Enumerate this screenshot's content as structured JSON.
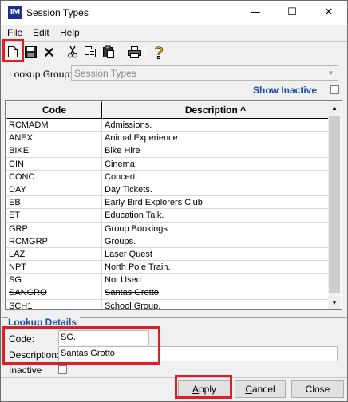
{
  "window": {
    "app_icon": "IM",
    "title": "Session Types",
    "minimize": "—",
    "maximize": "☐",
    "close": "✕"
  },
  "menu": [
    {
      "label": "File",
      "accel": "F",
      "rest": "ile"
    },
    {
      "label": "Edit",
      "accel": "E",
      "rest": "dit"
    },
    {
      "label": "Help",
      "accel": "H",
      "rest": "elp"
    }
  ],
  "toolbar": {
    "icons": [
      "new-document-icon",
      "save-icon",
      "delete-icon",
      "cut-icon",
      "copy-icon",
      "paste-icon",
      "print-icon",
      "help-icon"
    ]
  },
  "lookup": {
    "label": "Lookup Group:",
    "value": "Session Types"
  },
  "show_inactive": {
    "label": "Show Inactive",
    "checked": false
  },
  "grid": {
    "columns": [
      "Code",
      "Description ^"
    ],
    "rows": [
      {
        "code": "RCMADM",
        "description": "Admissions.",
        "inactive": false
      },
      {
        "code": "ANEX",
        "description": "Animal Experience.",
        "inactive": false
      },
      {
        "code": "BIKE",
        "description": "Bike Hire",
        "inactive": false
      },
      {
        "code": "CIN",
        "description": "Cinema.",
        "inactive": false
      },
      {
        "code": "CONC",
        "description": "Concert.",
        "inactive": false
      },
      {
        "code": "DAY",
        "description": "Day Tickets.",
        "inactive": false
      },
      {
        "code": "EB",
        "description": "Early Bird Explorers Club",
        "inactive": false
      },
      {
        "code": "ET",
        "description": "Education Talk.",
        "inactive": false
      },
      {
        "code": "GRP",
        "description": "Group Bookings",
        "inactive": false
      },
      {
        "code": "RCMGRP",
        "description": "Groups.",
        "inactive": false
      },
      {
        "code": "LAZ",
        "description": "Laser Quest",
        "inactive": false
      },
      {
        "code": "NPT",
        "description": "North Pole Train.",
        "inactive": false
      },
      {
        "code": "SG",
        "description": "Not Used",
        "inactive": false
      },
      {
        "code": "SANGRO",
        "description": "Santas Grotto",
        "inactive": true
      },
      {
        "code": "SCH1",
        "description": "School Group.",
        "inactive": false
      }
    ]
  },
  "details": {
    "title": "Lookup Details",
    "code_label": "Code:",
    "code_value": "SG.",
    "description_label": "Description:",
    "description_value": "Santas Grotto",
    "inactive_label": "Inactive",
    "inactive_checked": false
  },
  "buttons": {
    "apply": {
      "label": "Apply",
      "accel": "A",
      "rest": "pply"
    },
    "cancel": {
      "label": "Cancel",
      "accel": "C",
      "rest": "ancel"
    },
    "close": {
      "label": "Close"
    }
  },
  "colors": {
    "highlight": "#e21b24",
    "section_title": "#1a4fa0",
    "app_icon_bg": "#1b2f8c"
  }
}
